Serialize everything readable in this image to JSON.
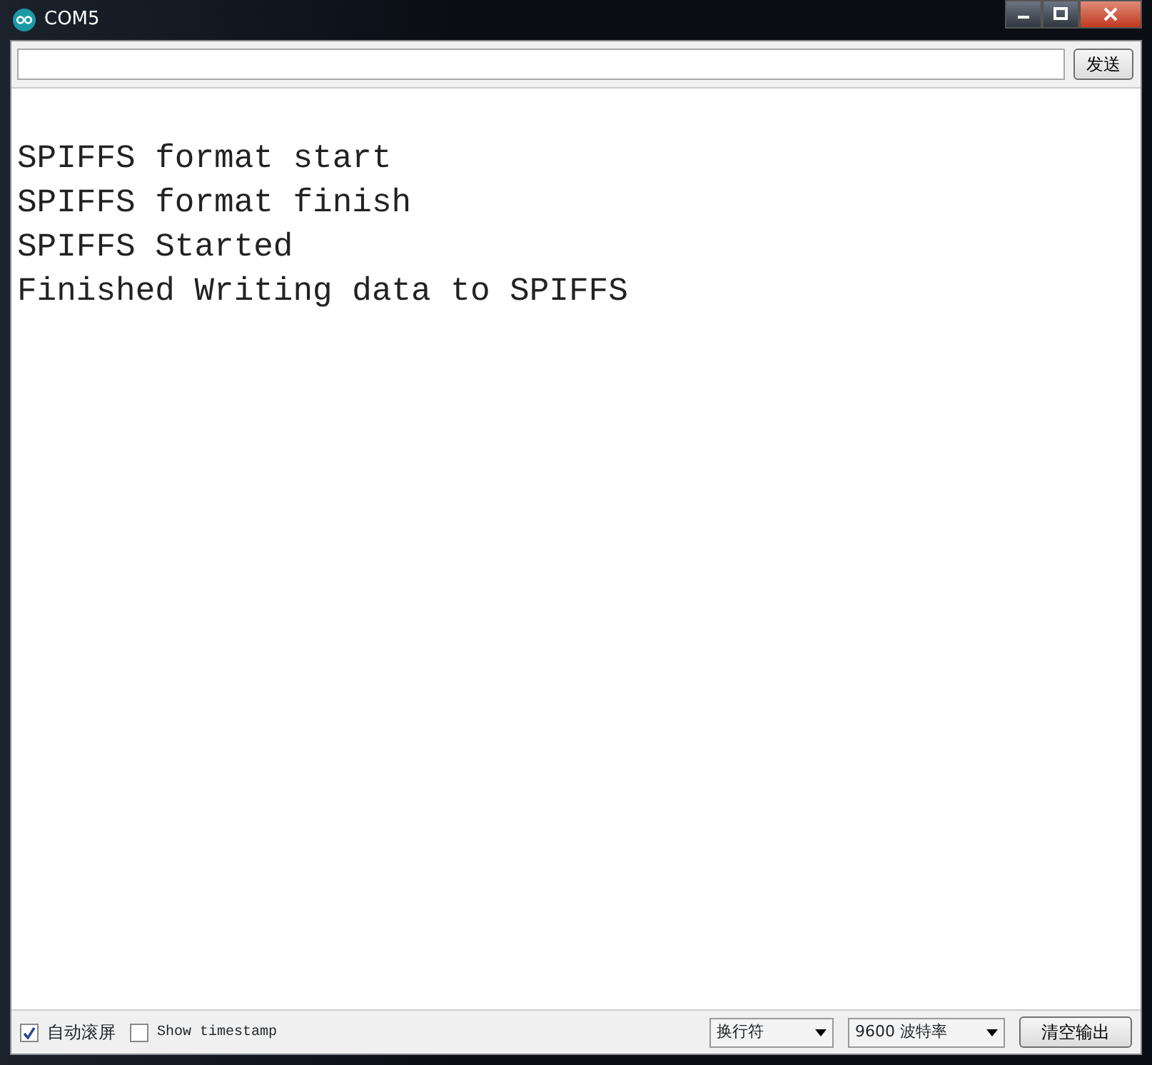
{
  "window": {
    "title": "COM5"
  },
  "send": {
    "button": "发送"
  },
  "output": [
    "SPIFFS format start",
    "SPIFFS format finish",
    "SPIFFS Started",
    "Finished Writing data to SPIFFS"
  ],
  "footer": {
    "autoscroll": {
      "label": "自动滚屏",
      "checked": true
    },
    "timestamp": {
      "label": "Show timestamp",
      "checked": false
    },
    "line_ending": "换行符",
    "baud": "9600 波特率",
    "clear": "清空输出"
  }
}
